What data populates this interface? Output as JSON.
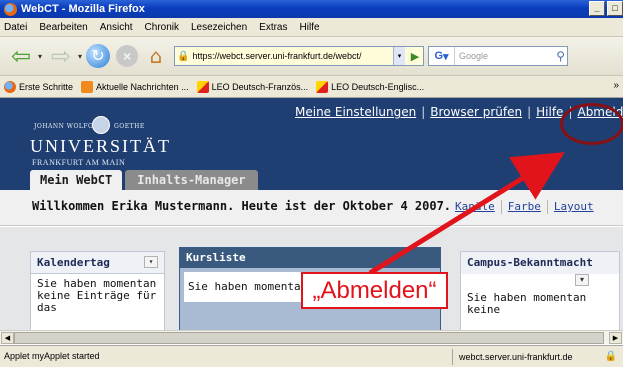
{
  "window": {
    "title": "WebCT - Mozilla Firefox",
    "minimize_label": "_",
    "maximize_label": "□"
  },
  "menu": [
    "Datei",
    "Bearbeiten",
    "Ansicht",
    "Chronik",
    "Lesezeichen",
    "Extras",
    "Hilfe"
  ],
  "navigation": {
    "url": "https://webct.server.uni-frankfurt.de/webct/",
    "search_placeholder": "Google",
    "search_engine": "G"
  },
  "bookmarks": [
    {
      "label": "Erste Schritte",
      "icon": "firefox-icon"
    },
    {
      "label": "Aktuelle Nachrichten ...",
      "icon": "rss-icon"
    },
    {
      "label": "LEO Deutsch-Französ...",
      "icon": "leo-icon"
    },
    {
      "label": "LEO Deutsch-Englisc...",
      "icon": "leo-icon"
    }
  ],
  "page": {
    "logo": {
      "small_left": "JOHANN WOLFGANG",
      "small_right": "GOETHE",
      "name": "UNIVERSITÄT",
      "city": "FRANKFURT AM MAIN"
    },
    "top_links": [
      "Meine Einstellungen",
      "Browser prüfen",
      "Hilfe",
      "Abmelden"
    ],
    "top_links_separator": "|",
    "tabs": [
      "Mein WebCT",
      "Inhalts-Manager"
    ],
    "welcome": "Willkommen Erika Mustermann. Heute ist der Oktober 4 2007.",
    "settings_links": [
      "Kanäle",
      "Farbe",
      "Layout"
    ],
    "cards": {
      "calendar": {
        "title": "Kalendertag",
        "text": "Sie haben momentan keine Einträge für das",
        "toggle_glyph": "▾"
      },
      "courses": {
        "title": "Kursliste",
        "text": "Sie haben momentan"
      },
      "campus": {
        "title": "Campus-Bekanntmacht",
        "text": "Sie haben momentan keine",
        "toggle_glyph": "▾"
      }
    }
  },
  "status": {
    "left": "Applet myApplet started",
    "right": "webct.server.uni-frankfurt.de"
  },
  "annotation": {
    "callout": "„Abmelden“",
    "color": "#e0141a"
  }
}
